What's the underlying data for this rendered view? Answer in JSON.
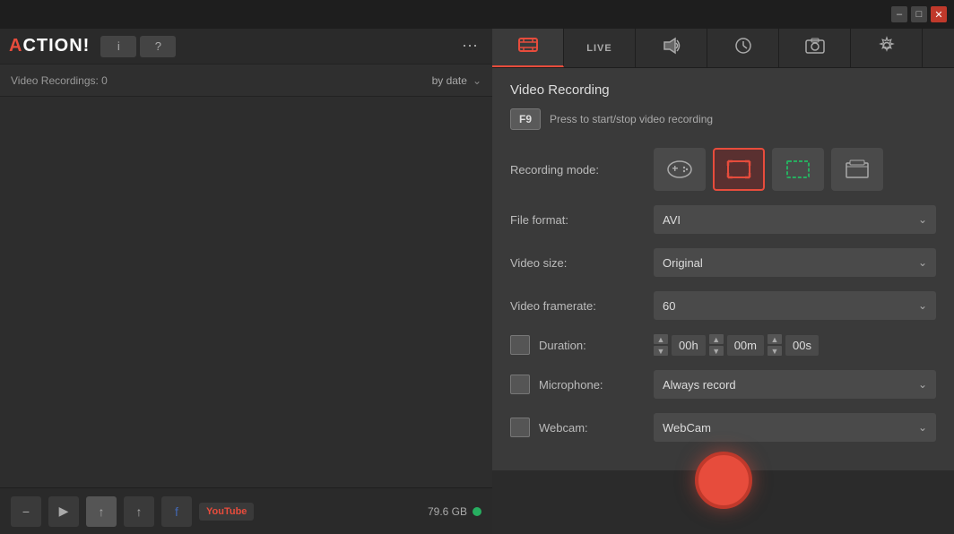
{
  "titlebar": {
    "min_label": "–",
    "max_label": "□",
    "close_label": "✕"
  },
  "app": {
    "logo": "ACTION!",
    "info_btn": "i",
    "help_btn": "?",
    "dots_label": "⋯"
  },
  "left_panel": {
    "filter_text": "Video Recordings: 0",
    "sort_label": "by date",
    "sort_icon": "⌄",
    "storage_label": "79.6 GB"
  },
  "toolbar": {
    "minus_label": "−",
    "play_label": "▶",
    "upload_label": "↑",
    "export_label": "↑",
    "fb_label": "f",
    "youtube_label": "YouTube"
  },
  "tabs": [
    {
      "id": "video",
      "label": "🎬",
      "active": true
    },
    {
      "id": "live",
      "label": "LIVE",
      "active": false
    },
    {
      "id": "audio",
      "label": "🔊",
      "active": false
    },
    {
      "id": "schedule",
      "label": "⏰",
      "active": false
    },
    {
      "id": "screenshot",
      "label": "📷",
      "active": false
    },
    {
      "id": "settings",
      "label": "⚙",
      "active": false
    }
  ],
  "video_recording": {
    "title": "Video Recording",
    "shortcut_key": "F9",
    "shortcut_desc": "Press to start/stop video recording",
    "recording_mode_label": "Recording mode:",
    "modes": [
      {
        "id": "gamepad",
        "icon": "🎮",
        "active": false
      },
      {
        "id": "fullscreen",
        "icon": "⬛",
        "active": true
      },
      {
        "id": "region",
        "icon": "⬜",
        "active": false
      },
      {
        "id": "window",
        "icon": "▣",
        "active": false
      }
    ],
    "file_format_label": "File format:",
    "file_format_value": "AVI",
    "video_size_label": "Video size:",
    "video_size_value": "Original",
    "video_framerate_label": "Video framerate:",
    "video_framerate_value": "60",
    "duration_label": "Duration:",
    "duration_hours": "00h",
    "duration_minutes": "00m",
    "duration_seconds": "00s",
    "microphone_label": "Microphone:",
    "microphone_value": "Always record",
    "webcam_label": "Webcam:",
    "webcam_value": "WebCam"
  },
  "colors": {
    "accent": "#e74c3c",
    "active_tab_bg": "#3a3a3a",
    "inactive_tab_bg": "#2f2f2f"
  }
}
